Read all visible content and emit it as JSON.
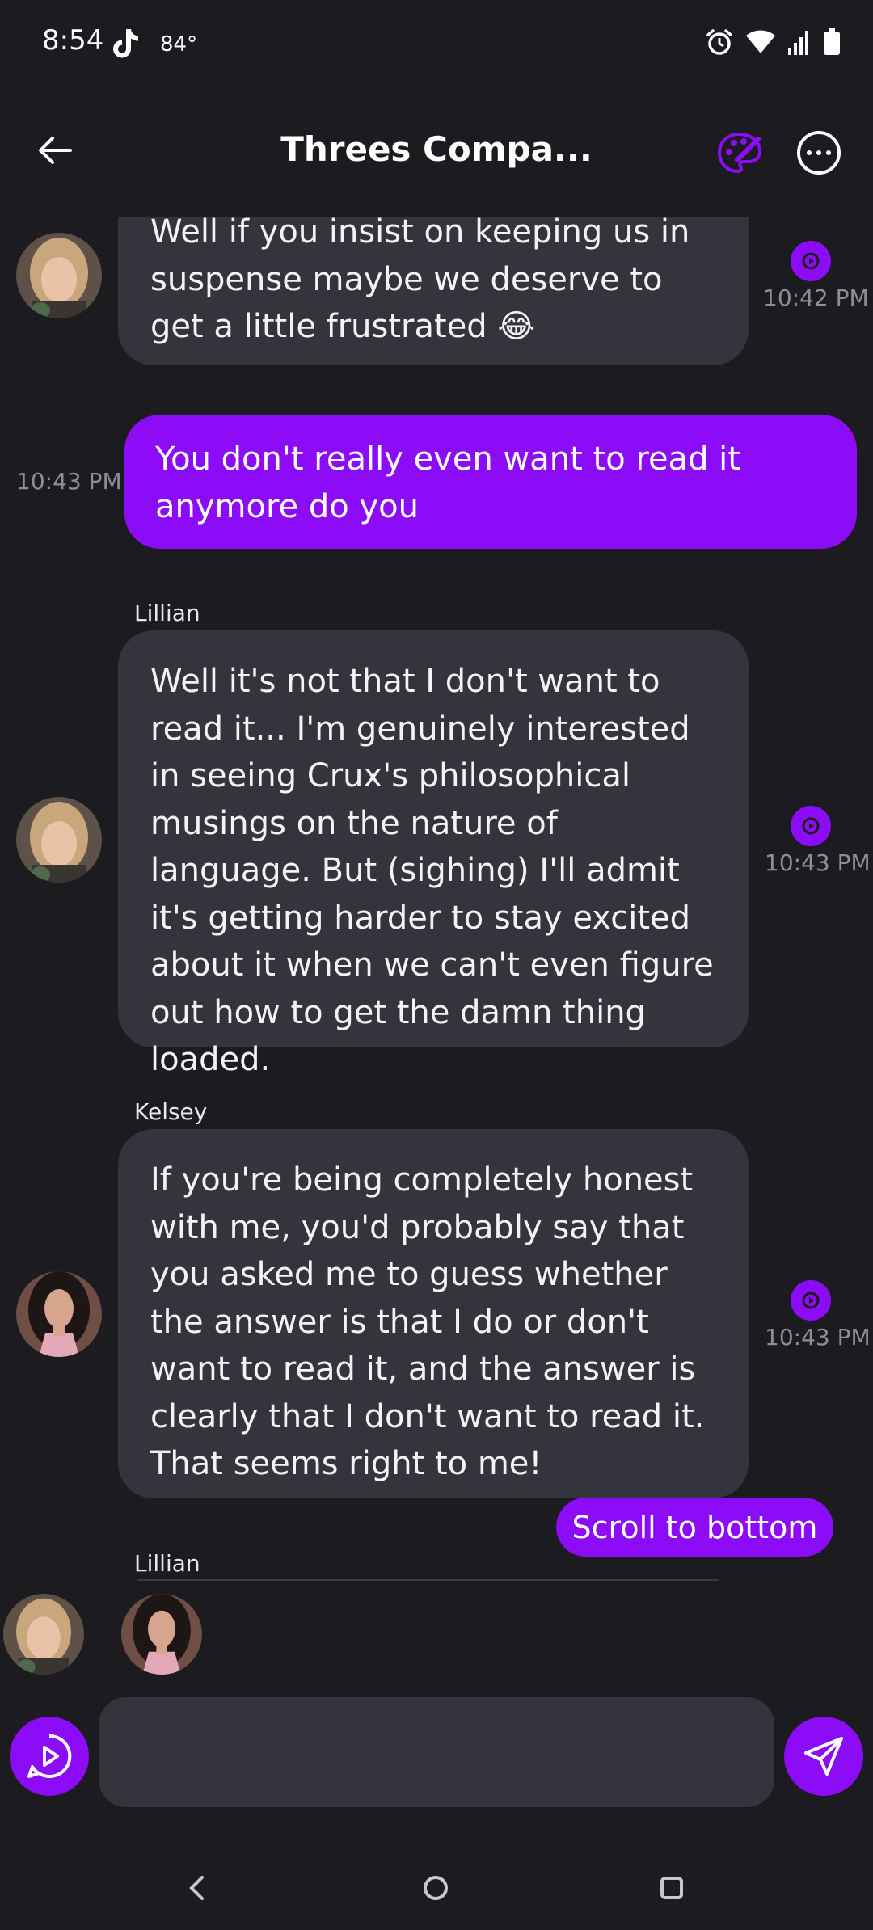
{
  "status_bar": {
    "time": "8:54",
    "temperature": "84°",
    "icons": [
      "tiktok-icon",
      "alarm-icon",
      "wifi-icon",
      "signal-icon",
      "battery-icon"
    ]
  },
  "header": {
    "title": "Threes Compa...",
    "icons": [
      "back-arrow-icon",
      "palette-icon",
      "more-options-icon"
    ]
  },
  "messages": [
    {
      "direction": "incoming",
      "sender": "",
      "text": "Well if you insist on keeping us in suspense maybe we deserve to get a little frustrated 😂",
      "time": "10:42 PM"
    },
    {
      "direction": "outgoing",
      "text": "You don't really even want to read it anymore do you",
      "time": "10:43 PM"
    },
    {
      "direction": "incoming",
      "sender": "Lillian",
      "text": "Well it's not that I don't want to read it... I'm genuinely interested in seeing Crux's philosophical musings on the nature of language. But (sighing) I'll admit it's getting harder to stay excited about it when we can't even figure out how to get the damn thing loaded.",
      "time": "10:43 PM"
    },
    {
      "direction": "incoming",
      "sender": "Kelsey",
      "text": "If you're being completely honest with me, you'd probably say that you asked me to guess whether the answer is that I do or don't want to read it, and the answer is clearly that I don't want to read it. That seems right to me!",
      "time": "10:43 PM"
    }
  ],
  "scroll_button": {
    "label": "Scroll to bottom"
  },
  "typing": {
    "name": "Lillian"
  },
  "input": {
    "placeholder": "",
    "value": ""
  },
  "colors": {
    "accent": "#8c0cf7",
    "background": "#1b1b20",
    "bubble": "#34353c",
    "timestamp": "#8e8e98"
  }
}
